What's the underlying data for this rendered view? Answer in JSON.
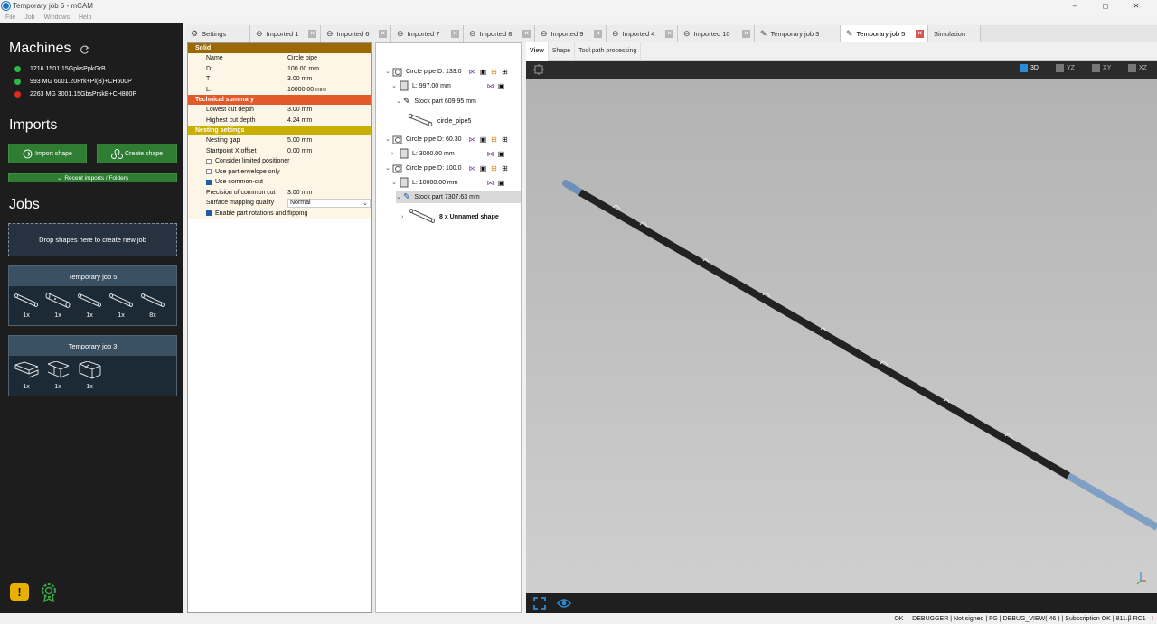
{
  "window": {
    "title": "Temporary job 5 - mCAM",
    "minimize": "–",
    "maximize": "◻",
    "close": "✕"
  },
  "menu": [
    "File",
    "Job",
    "Windows",
    "Help"
  ],
  "sidebar": {
    "machines_title": "Machines",
    "machines": [
      {
        "label": "1216 1501.15GpksPpkGrB",
        "color": "#2db84b"
      },
      {
        "label": "993 MG 6001.20Prk+Pl(B)+CH500P",
        "color": "#2db84b"
      },
      {
        "label": "2263 MG  3001.15GbsPrskB+CH800P",
        "color": "#e0281c"
      }
    ],
    "imports_title": "Imports",
    "import_shape": "Import shape",
    "create_shape": "Create shape",
    "recent": "Recent imports / Folders",
    "jobs_title": "Jobs",
    "drop_text": "Drop shapes here to create new job",
    "jobs": [
      {
        "title": "Temporary job 5",
        "counts": [
          "1x",
          "1x",
          "1x",
          "1x",
          "8x"
        ]
      },
      {
        "title": "Temporary job 3",
        "counts": [
          "1x",
          "1x",
          "1x"
        ]
      }
    ]
  },
  "tabs": [
    {
      "label": "Settings",
      "icon": "gear-icon"
    },
    {
      "label": "Imported 1",
      "icon": "import-icon"
    },
    {
      "label": "Imported 6",
      "icon": "import-icon"
    },
    {
      "label": "Imported 7",
      "icon": "import-icon"
    },
    {
      "label": "Imported 8",
      "icon": "import-icon"
    },
    {
      "label": "Imported 9",
      "icon": "import-icon"
    },
    {
      "label": "Imported 4",
      "icon": "import-icon"
    },
    {
      "label": "Imported 10",
      "icon": "import-icon"
    },
    {
      "label": "Temporary job 3",
      "icon": "pen-icon"
    },
    {
      "label": "Temporary job 5",
      "icon": "pen-icon",
      "active": true
    },
    {
      "label": "Simulation",
      "icon": ""
    }
  ],
  "props": {
    "solid_title": "Solid",
    "solid_color": "#9a6a00",
    "solid": [
      {
        "k": "Name",
        "v": "Circle pipe"
      },
      {
        "k": "D:",
        "v": "100.00 mm"
      },
      {
        "k": "T",
        "v": "3.00 mm"
      },
      {
        "k": "L:",
        "v": "10000.00 mm"
      }
    ],
    "tech_title": "Technical summary",
    "tech_color": "#e05a2a",
    "tech": [
      {
        "k": "Lowest cut depth",
        "v": "3.00 mm"
      },
      {
        "k": "Highest cut depth",
        "v": "4.24 mm"
      }
    ],
    "nest_title": "Nesting settings",
    "nest_color": "#c9b000",
    "nest": [
      {
        "k": "Nesting gap",
        "v": "5.00 mm"
      },
      {
        "k": "Startpoint X offset",
        "v": "0.00 mm"
      }
    ],
    "checks": [
      {
        "label": "Consider limited positioner",
        "on": false
      },
      {
        "label": "Use part envelope only",
        "on": false
      },
      {
        "label": "Use common-cut",
        "on": true
      }
    ],
    "precision": {
      "k": "Precision of common cut",
      "v": "3.00 mm"
    },
    "surface": {
      "k": "Surface mapping quality",
      "v": "Normal"
    },
    "rotation": {
      "label": "Enable part rotations and flipping",
      "on": true
    }
  },
  "tree": [
    {
      "label": "Circle pipe D: 133.0",
      "level": 0,
      "expanded": true,
      "icons": true
    },
    {
      "label": "L: 997.00 mm",
      "level": 1,
      "expanded": true,
      "icons2": true
    },
    {
      "label": "Stock part 609.95 mm",
      "level": 2,
      "expanded": true
    },
    {
      "label": "circle_pipe5",
      "level": 3
    },
    {
      "label": "Circle pipe D: 60.30",
      "level": 0,
      "expanded": true,
      "icons": true
    },
    {
      "label": "L: 3000.00 mm",
      "level": 1,
      "expanded": false,
      "icons2": true
    },
    {
      "label": "Circle pipe D: 100.0",
      "level": 0,
      "expanded": true,
      "icons": true
    },
    {
      "label": "L: 10000.00 mm",
      "level": 1,
      "expanded": true,
      "icons2": true
    },
    {
      "label": "Stock part 7307.63 mm",
      "level": 2,
      "expanded": true,
      "selected": true
    },
    {
      "label": "8 x Unnamed shape",
      "level": 3,
      "bold": true
    }
  ],
  "view": {
    "tabs": [
      "View",
      "Shape",
      "Tool path processing"
    ],
    "views": [
      "3D",
      "YZ",
      "XY",
      "XZ"
    ]
  },
  "status": "OK     DEBUGGER | Not signed | FG | DEBUG_VIEW( 46 ) | Subscription OK | 811.β RC1"
}
